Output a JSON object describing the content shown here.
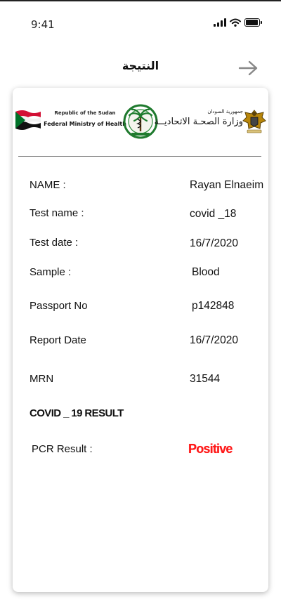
{
  "status_bar": {
    "time": "9:41"
  },
  "header": {
    "title": "النتيجة",
    "back_icon": "arrow-icon"
  },
  "certificate": {
    "republic_en": "Republic of the Sudan",
    "ministry_en": "Federal Ministry of Health",
    "republic_ar": "جمهورية السودان",
    "ministry_ar": "وزارة الصحـة الاتحاديــة",
    "fields": [
      {
        "label": "NAME :",
        "value": "Rayan Elnaeim"
      },
      {
        "label": "Test name :",
        "value": "covid _18"
      },
      {
        "label": "Test date :",
        "value": "16/7/2020"
      },
      {
        "label": "Sample :",
        "value": "Blood"
      },
      {
        "label": "Passport No",
        "value": "p142848"
      },
      {
        "label": "Report Date",
        "value": "16/7/2020"
      },
      {
        "label": "MRN",
        "value": "31544"
      }
    ],
    "result_section_title": "COVID _ 19 RESULT",
    "pcr_label": "PCR Result :",
    "pcr_value": "Positive"
  },
  "colors": {
    "positive": "#ff1a1a",
    "flag_red": "#d21034",
    "flag_green": "#007229",
    "emblem_gold": "#b8860b"
  }
}
